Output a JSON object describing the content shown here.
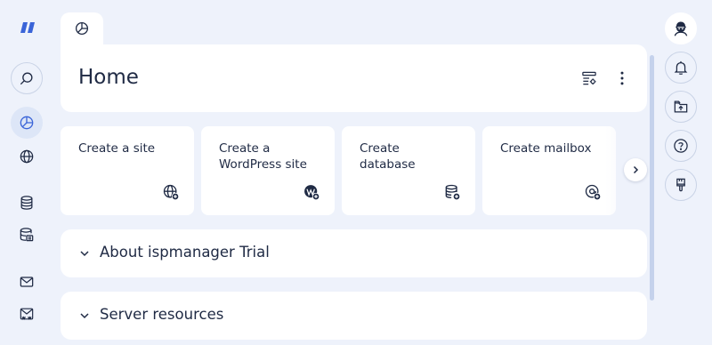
{
  "header": {
    "title": "Home"
  },
  "actions": [
    {
      "label": "Create a site",
      "icon": "globe-plus-icon"
    },
    {
      "label": "Create a WordPress site",
      "icon": "wordpress-plus-icon"
    },
    {
      "label": "Create database",
      "icon": "database-plus-icon"
    },
    {
      "label": "Create mailbox",
      "icon": "mailbox-plus-icon"
    }
  ],
  "sections": [
    {
      "title": "About ispmanager Trial"
    },
    {
      "title": "Server resources"
    }
  ],
  "icons": {
    "logo": "ispmanager-logo",
    "left_nav": [
      "search-icon",
      "dashboard-icon",
      "globe-icon",
      "database-icon",
      "database-list-icon",
      "mail-icon",
      "www-mail-icon"
    ],
    "right_nav": [
      "user-avatar-icon",
      "bell-icon",
      "upload-folder-icon",
      "help-icon",
      "brush-icon"
    ]
  },
  "colors": {
    "background": "#eef2fb",
    "card": "#ffffff",
    "accent": "#3a64d8",
    "text": "#1f2a44"
  }
}
